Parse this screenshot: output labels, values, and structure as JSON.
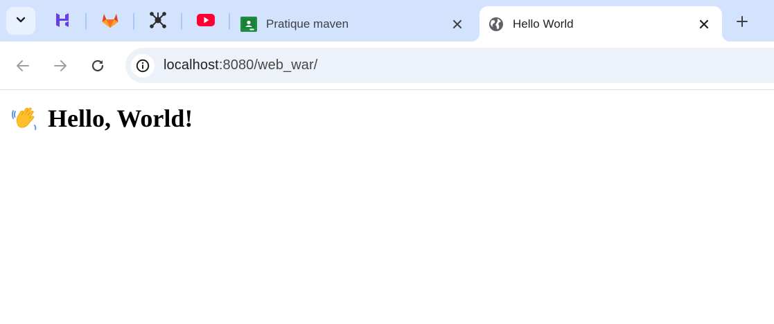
{
  "browser": {
    "tabs": [
      {
        "title": "Pratique maven",
        "favicon": "google-classroom-icon",
        "active": false
      },
      {
        "title": "Hello World",
        "favicon": "globe-icon",
        "active": true
      }
    ],
    "pinned_tabs": [
      "hostinger-icon",
      "gitlab-icon",
      "graph-network-icon",
      "youtube-icon"
    ],
    "address_bar": {
      "host": "localhost",
      "rest": ":8080/web_war/"
    },
    "colors": {
      "tabstrip": "#d3e3fd",
      "omnibox": "#edf2fa",
      "active_tab": "#ffffff"
    }
  },
  "page": {
    "heading_emoji": "👋",
    "heading_text": "Hello, World!"
  }
}
